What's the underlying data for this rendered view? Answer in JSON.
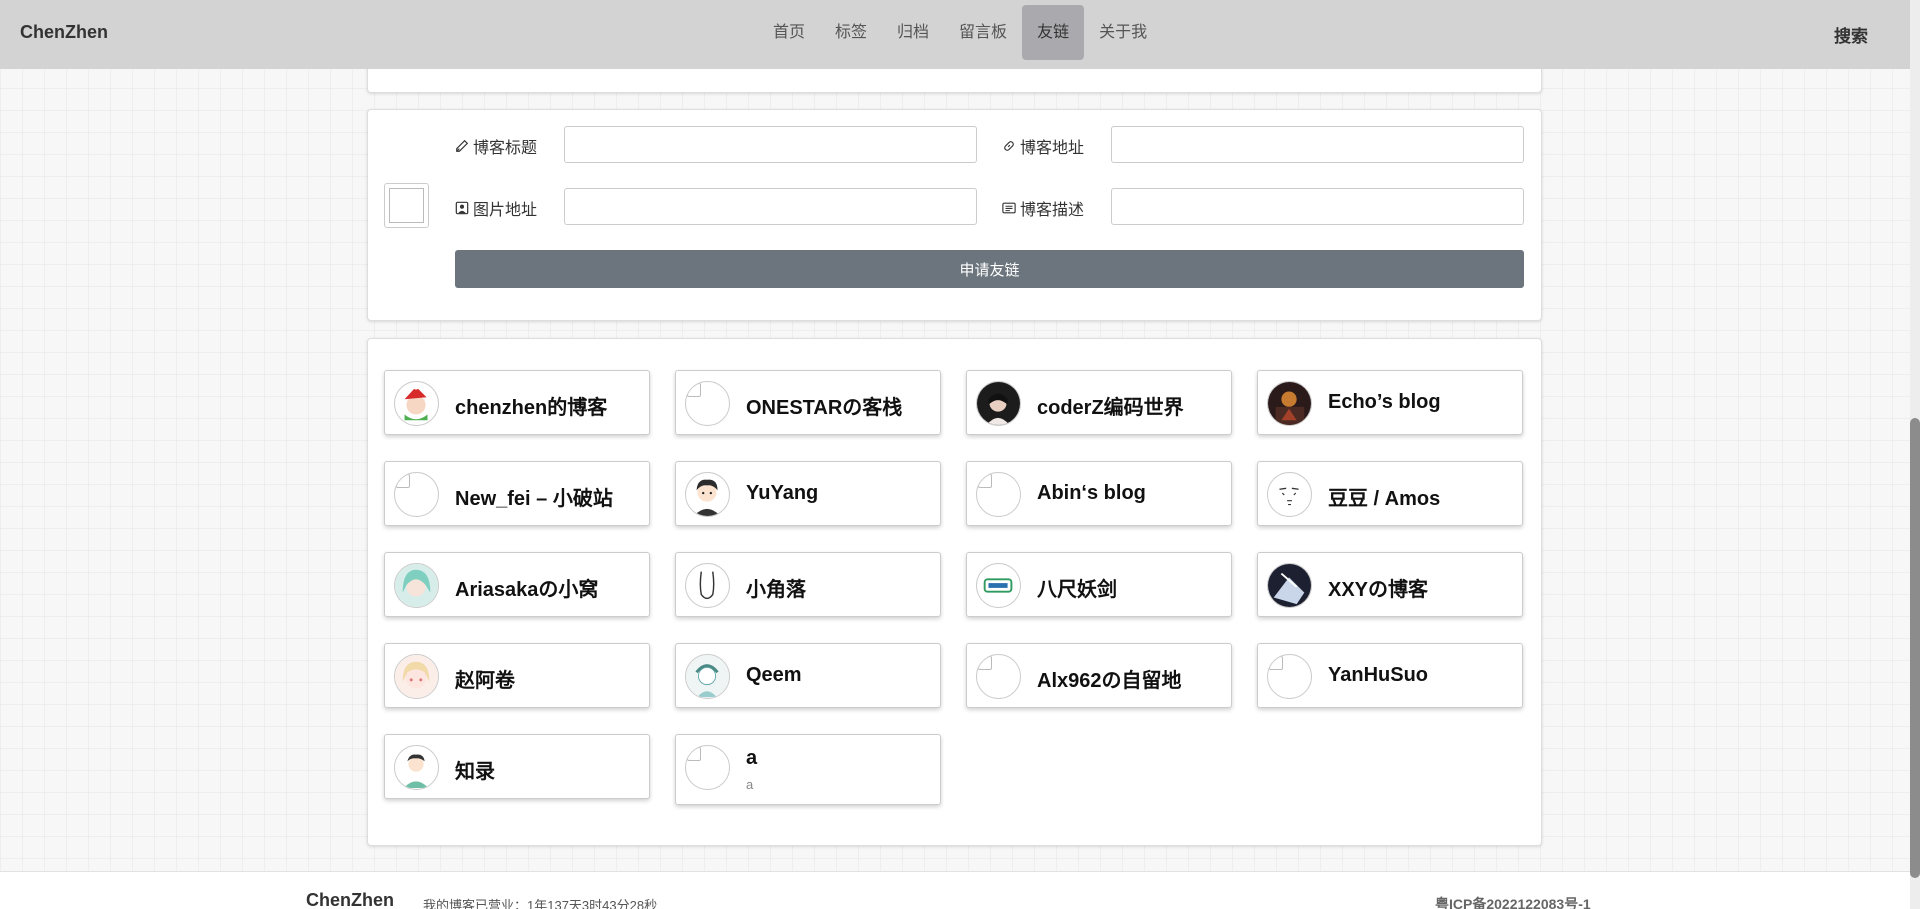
{
  "nav": {
    "brand": "ChenZhen",
    "items": [
      {
        "label": "首页",
        "active": false
      },
      {
        "label": "标签",
        "active": false
      },
      {
        "label": "归档",
        "active": false
      },
      {
        "label": "留言板",
        "active": false
      },
      {
        "label": "友链",
        "active": true
      },
      {
        "label": "关于我",
        "active": false
      }
    ],
    "search_label": "搜索"
  },
  "form": {
    "title_label": "博客标题",
    "address_label": "博客地址",
    "image_label": "图片地址",
    "desc_label": "博客描述",
    "title_value": "",
    "address_value": "",
    "image_value": "",
    "desc_value": "",
    "submit_label": "申请友链"
  },
  "links": [
    {
      "title": "chenzhen的博客",
      "desc": "",
      "avatar": "santa-character-avatar"
    },
    {
      "title": "ONESTARの客栈",
      "desc": "",
      "avatar": "broken-image"
    },
    {
      "title": "coderZ编码世界",
      "desc": "",
      "avatar": "dark-portrait-avatar"
    },
    {
      "title": "Echo’s blog",
      "desc": "",
      "avatar": "night-scene-avatar"
    },
    {
      "title": "New_fei – 小破站",
      "desc": "",
      "avatar": "broken-image"
    },
    {
      "title": "YuYang",
      "desc": "",
      "avatar": "cartoon-boy-avatar"
    },
    {
      "title": "Abin‘s blog",
      "desc": "",
      "avatar": "broken-image"
    },
    {
      "title": "豆豆 / Amos",
      "desc": "",
      "avatar": "sketch-face-avatar"
    },
    {
      "title": "Ariasakaの小窝",
      "desc": "",
      "avatar": "anime-girl-avatar"
    },
    {
      "title": "小角落",
      "desc": "",
      "avatar": "line-art-avatar"
    },
    {
      "title": "八尺妖剑",
      "desc": "",
      "avatar": "logo-badge-avatar"
    },
    {
      "title": "XXYの博客",
      "desc": "",
      "avatar": "dark-anime-avatar"
    },
    {
      "title": "赵阿卷",
      "desc": "",
      "avatar": "pink-anime-avatar"
    },
    {
      "title": "Qeem",
      "desc": "",
      "avatar": "teal-character-avatar"
    },
    {
      "title": "Alx962の自留地",
      "desc": "",
      "avatar": "broken-image"
    },
    {
      "title": "YanHuSuo",
      "desc": "",
      "avatar": "broken-image"
    },
    {
      "title": "知录",
      "desc": "",
      "avatar": "cartoon-person-avatar"
    },
    {
      "title": "a",
      "desc": "a",
      "avatar": "broken-image"
    }
  ],
  "footer": {
    "brand": "ChenZhen",
    "uptime": "我的博客已营业：1年137天3时43分28秒",
    "icp": "粤ICP备2022122083号-1"
  },
  "colors": {
    "nav_bg": "#d3d3d3",
    "nav_active_bg": "#a9a9ae",
    "button_bg": "#6c757d"
  }
}
